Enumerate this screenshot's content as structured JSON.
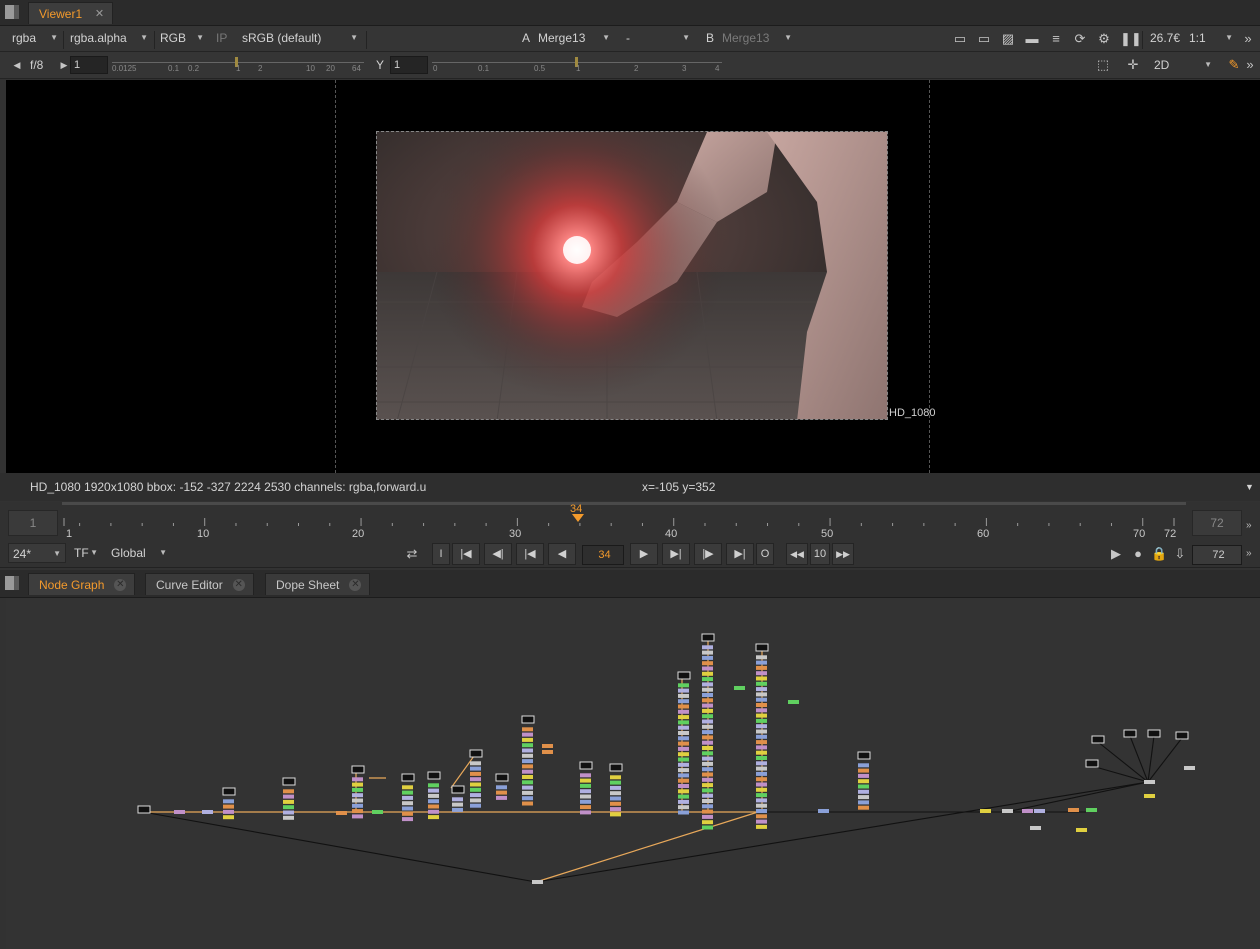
{
  "viewer_tab": {
    "label": "Viewer1",
    "close": "✕"
  },
  "viewer_toolbar": {
    "channels": "rgba",
    "alpha": "rgba.alpha",
    "display": "RGB",
    "ip": "IP",
    "colorspace": "sRGB (default)",
    "a_label": "A",
    "a_input": "Merge13",
    "op": "-",
    "b_label": "B",
    "b_input": "Merge13",
    "zoom": "26.7€",
    "ratio": "1:1"
  },
  "exposure_row": {
    "fstop": "f/8",
    "gain": "1",
    "gain_ticks": [
      "0.0125",
      "0.1",
      "0.2",
      "1",
      "2",
      "10",
      "20",
      "64"
    ],
    "y_label": "Y",
    "gamma": "1",
    "gamma_ticks": [
      "0",
      "0.1",
      "0.5",
      "1",
      "2",
      "3",
      "4"
    ],
    "view_mode": "2D"
  },
  "viewer": {
    "format_label": "HD_1080",
    "info_left": "HD_1080 1920x1080  bbox: -152 -327 2224 2530 channels: rgba,forward.u",
    "info_coords": "x=-105 y=352"
  },
  "timeline": {
    "in_frame": "1",
    "out_frame": "72",
    "current": "34",
    "ticks": [
      "1",
      "10",
      "20",
      "30",
      "40",
      "50",
      "60",
      "70",
      "72"
    ]
  },
  "transport": {
    "fps": "24*",
    "tf": "TF",
    "range": "Global",
    "in_btn": "I",
    "out_btn": "O",
    "frame": "34",
    "step": "10",
    "end_frame": "72"
  },
  "bottom_tabs": [
    {
      "label": "Node Graph"
    },
    {
      "label": "Curve Editor"
    },
    {
      "label": "Dope Sheet"
    }
  ],
  "colors": {
    "accent": "#f39a2c",
    "panel": "#333333",
    "viewer_bg": "#000000"
  }
}
